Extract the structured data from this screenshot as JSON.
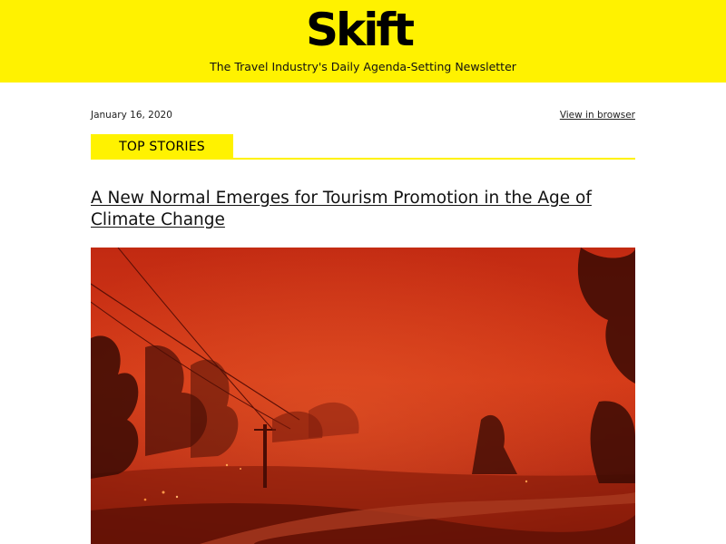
{
  "header": {
    "logo_text": "Skift",
    "tagline": "The Travel Industry's Daily Agenda-Setting Newsletter",
    "background_color": "#fff200"
  },
  "meta": {
    "date": "January 16, 2020",
    "view_in_browser": "View in browser"
  },
  "section": {
    "label": "TOP STORIES"
  },
  "story": {
    "headline": "A New Normal Emerges for Tourism Promotion in the Age of Climate Change",
    "image_icon": "bushfire-photo"
  }
}
